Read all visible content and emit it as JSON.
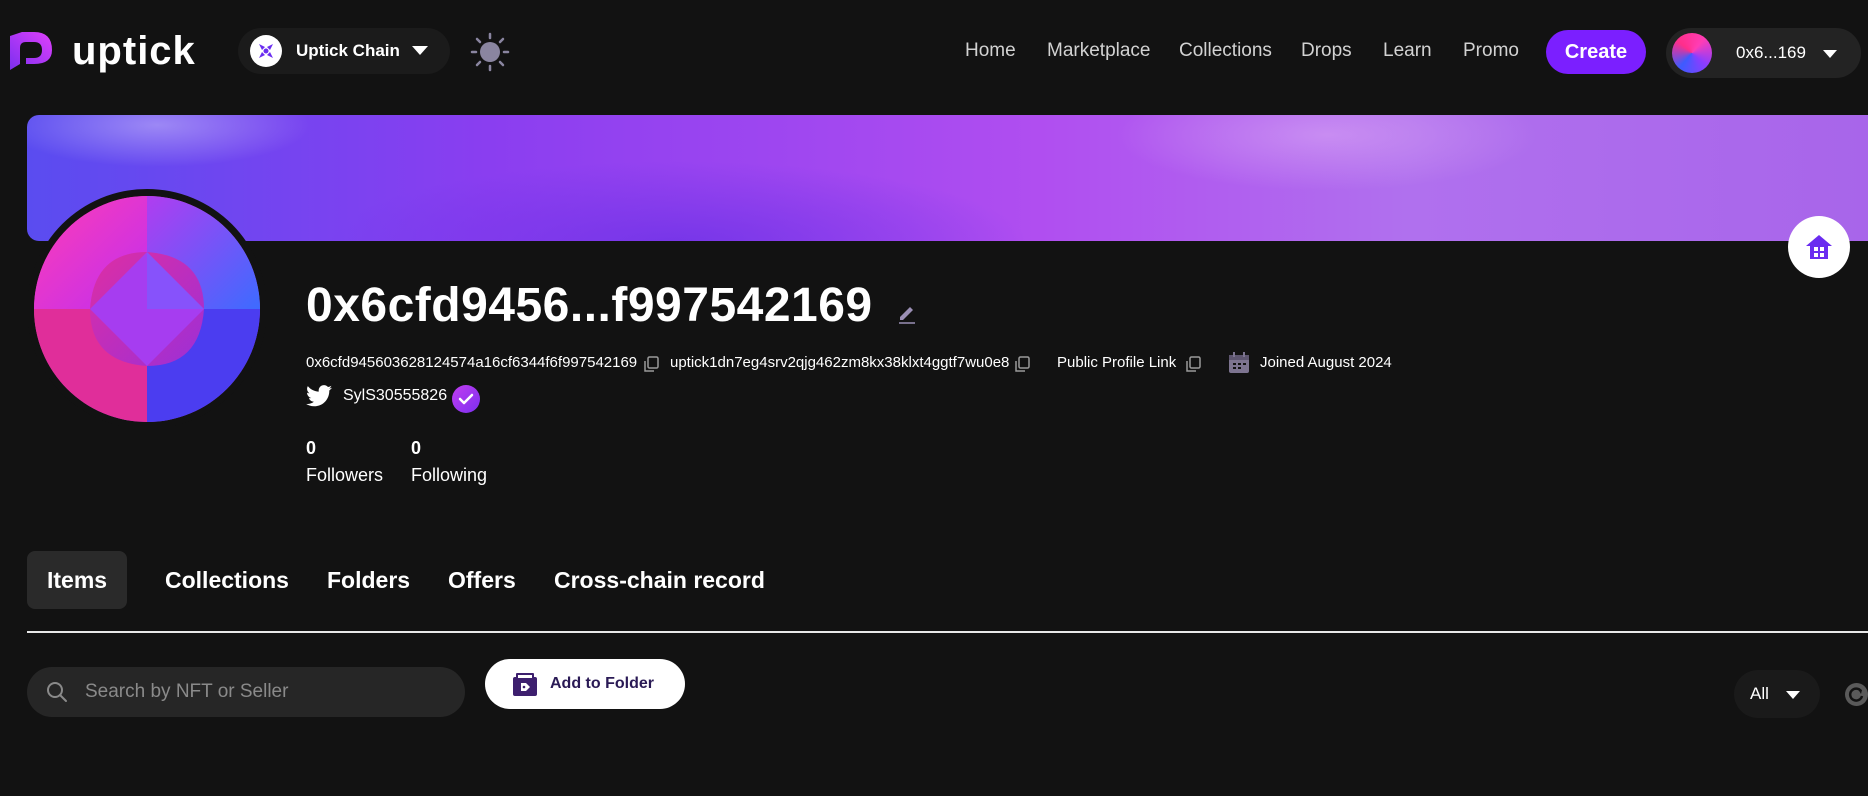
{
  "header": {
    "logo_text": "uptick",
    "chain_label": "Uptick Chain",
    "nav": [
      "Home",
      "Marketplace",
      "Collections",
      "Drops",
      "Learn",
      "Promo"
    ],
    "create_label": "Create",
    "wallet_label": "0x6...169"
  },
  "profile": {
    "name": "0x6cfd9456...f997542169",
    "evm_address": "0x6cfd945603628124574a16cf6344f6f997542169",
    "cosmos_address": "uptick1dn7eg4srv2qjg462zm8kx38klxt4ggtf7wu0e8",
    "public_link_label": "Public Profile Link",
    "joined": "Joined August 2024",
    "twitter_handle": "SylS30555826",
    "followers_count": "0",
    "followers_label": "Followers",
    "following_count": "0",
    "following_label": "Following"
  },
  "tabs": [
    "Items",
    "Collections",
    "Folders",
    "Offers",
    "Cross-chain record"
  ],
  "active_tab": "Items",
  "toolbar": {
    "search_placeholder": "Search by NFT or Seller",
    "add_folder_label": "Add to Folder",
    "filter_value": "All"
  },
  "colors": {
    "background": "#121212",
    "accent": "#7b1fff",
    "banner_start": "#5a4cf0",
    "banner_end": "#b070ee"
  },
  "icons": [
    "uptick-logo-icon",
    "chain-icon",
    "sun-icon",
    "home-icon",
    "edit-icon",
    "copy-icon",
    "calendar-icon",
    "twitter-icon",
    "verified-icon",
    "search-icon",
    "folder-icon",
    "refresh-icon"
  ]
}
